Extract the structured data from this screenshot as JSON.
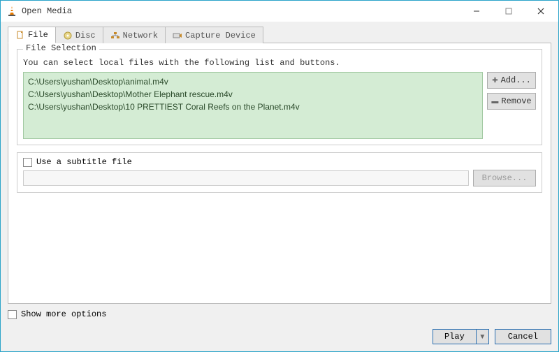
{
  "window": {
    "title": "Open Media"
  },
  "tabs": {
    "file": "File",
    "disc": "Disc",
    "network": "Network",
    "capture": "Capture Device"
  },
  "file_section": {
    "legend": "File Selection",
    "hint": "You can select local files with the following list and buttons.",
    "files": [
      "C:\\Users\\yushan\\Desktop\\animal.m4v",
      "C:\\Users\\yushan\\Desktop\\Mother Elephant rescue.m4v",
      "C:\\Users\\yushan\\Desktop\\10 PRETTIEST Coral Reefs on the Planet.m4v"
    ],
    "add_label": "Add...",
    "remove_label": "Remove"
  },
  "subtitle": {
    "checkbox_label": "Use a subtitle file",
    "browse_label": "Browse..."
  },
  "footer": {
    "show_more_label": "Show more options",
    "play_label": "Play",
    "cancel_label": "Cancel"
  }
}
